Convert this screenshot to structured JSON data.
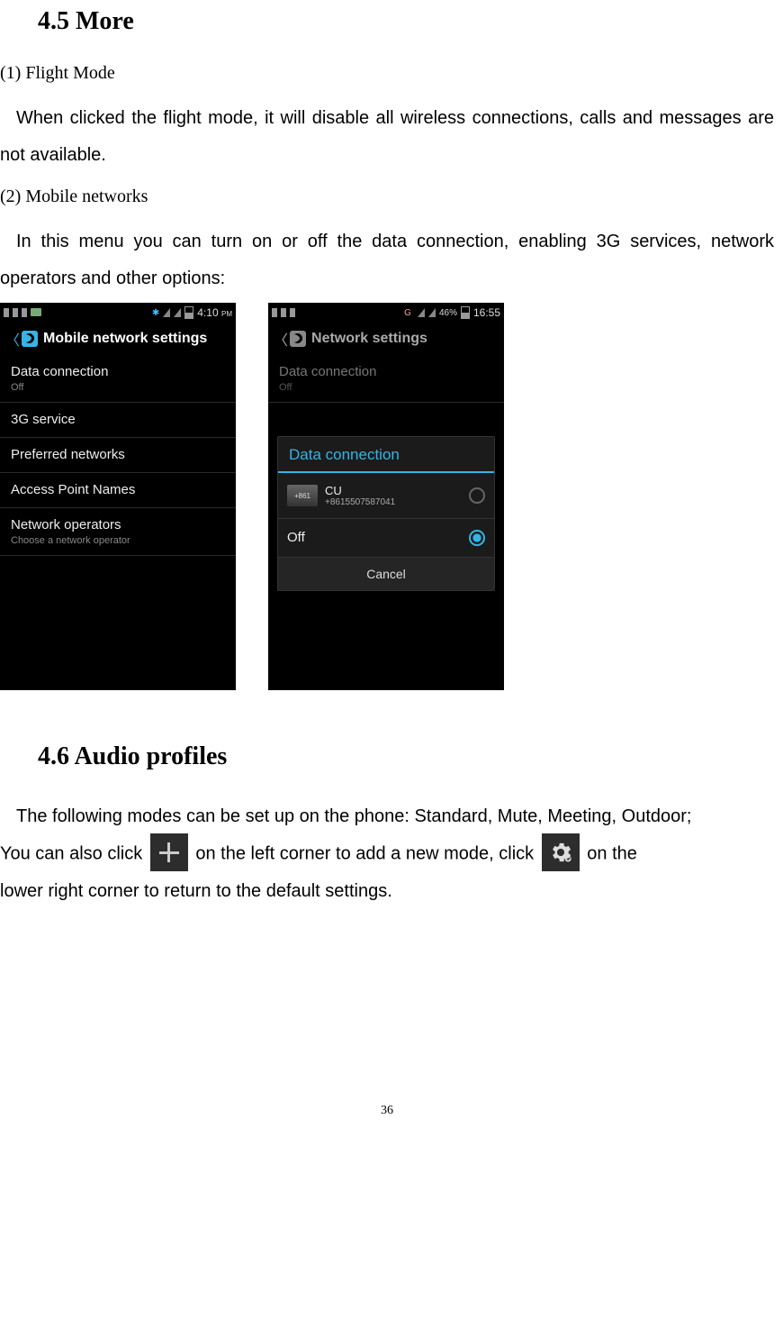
{
  "sections": {
    "more": {
      "heading": "4.5 More",
      "item1": {
        "label": "(1)  Flight Mode",
        "text": "When clicked the flight mode, it will disable all wireless connections, calls and messages are not available."
      },
      "item2": {
        "label": "(2) Mobile networks",
        "text": "In this menu you can turn on or off the data connection, enabling 3G services, network operators and other options:"
      }
    },
    "audio": {
      "heading": "4.6 Audio profiles",
      "para_a": "The following modes can be set up on the phone: Standard, Mute, Meeting, Outdoor;",
      "para_b_1": "You can also click",
      "para_b_2": "on the left corner to add a new mode, click",
      "para_b_3": "on the",
      "para_c": "lower right corner to return to the default settings."
    }
  },
  "screen1": {
    "time": "4:10",
    "ampm": "PM",
    "title": "Mobile network settings",
    "items": [
      {
        "pri": "Data connection",
        "sec": "Off"
      },
      {
        "pri": "3G service"
      },
      {
        "pri": "Preferred networks"
      },
      {
        "pri": "Access Point Names"
      },
      {
        "pri": "Network operators",
        "sec": "Choose a network operator"
      }
    ]
  },
  "screen2": {
    "time": "16:55",
    "batt": "46%",
    "g": "G",
    "title": "Network settings",
    "item": {
      "pri": "Data connection",
      "sec": "Off"
    },
    "dialog": {
      "title": "Data connection",
      "sim": {
        "tag": "+861",
        "name": "CU",
        "num": "+8615507587041"
      },
      "off": "Off",
      "cancel": "Cancel"
    }
  },
  "page_number": "36"
}
